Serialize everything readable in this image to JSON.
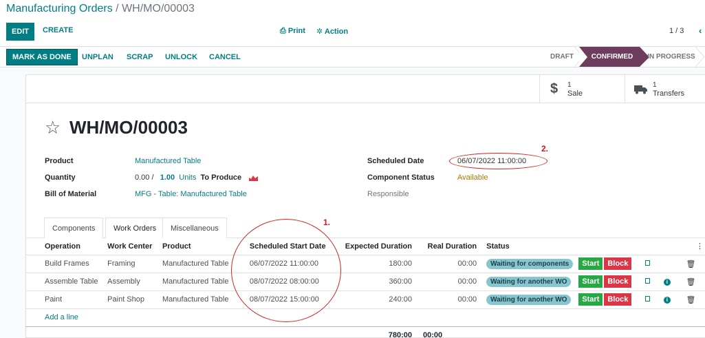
{
  "breadcrumb": {
    "parent": "Manufacturing Orders",
    "separator": " / ",
    "current": "WH/MO/00003"
  },
  "toolbar": {
    "edit_label": "EDIT",
    "create_label": "CREATE",
    "print_label": "Print",
    "action_label": "Action",
    "pager": "1 / 3"
  },
  "statusbar": {
    "mark_done_label": "MARK AS DONE",
    "buttons": [
      "UNPLAN",
      "SCRAP",
      "UNLOCK",
      "CANCEL"
    ],
    "stages": [
      {
        "label": "DRAFT",
        "active": false
      },
      {
        "label": "CONFIRMED",
        "active": true
      },
      {
        "label": "IN PROGRESS",
        "active": false
      }
    ]
  },
  "smart_buttons": [
    {
      "icon": "dollar-icon",
      "count": "1",
      "label": "Sale"
    },
    {
      "icon": "truck-icon",
      "count": "1",
      "label": "Transfers"
    }
  ],
  "record": {
    "title": "WH/MO/00003",
    "product_label": "Product",
    "product_value": "Manufactured Table",
    "quantity_label": "Quantity",
    "quantity_done": "0.00",
    "quantity_sep": " / ",
    "quantity_total": "1.00",
    "quantity_unit": "Units",
    "quantity_suffix": "To Produce",
    "bom_label": "Bill of Material",
    "bom_value": "MFG - Table: Manufactured Table",
    "scheduled_label": "Scheduled Date",
    "scheduled_value": "06/07/2022 11:00:00",
    "component_status_label": "Component Status",
    "component_status_value": "Available",
    "responsible_label": "Responsible"
  },
  "tabs": [
    {
      "label": "Components",
      "active": false
    },
    {
      "label": "Work Orders",
      "active": true
    },
    {
      "label": "Miscellaneous",
      "active": false
    }
  ],
  "work_orders": {
    "columns": [
      "Operation",
      "Work Center",
      "Product",
      "Scheduled Start Date",
      "Expected Duration",
      "Real Duration",
      "Status"
    ],
    "rows": [
      {
        "operation": "Build Frames",
        "work_center": "Framing",
        "product": "Manufactured Table",
        "start": "06/07/2022 11:00:00",
        "expected": "180:00",
        "real": "00:00",
        "status": "Waiting for components",
        "info": false
      },
      {
        "operation": "Assemble Table",
        "work_center": "Assembly",
        "product": "Manufactured Table",
        "start": "08/07/2022 08:00:00",
        "expected": "360:00",
        "real": "00:00",
        "status": "Waiting for another WO",
        "info": true
      },
      {
        "operation": "Paint",
        "work_center": "Paint Shop",
        "product": "Manufactured Table",
        "start": "08/07/2022 15:00:00",
        "expected": "240:00",
        "real": "00:00",
        "status": "Waiting for another WO",
        "info": true
      }
    ],
    "add_line_label": "Add a line",
    "start_label": "Start",
    "block_label": "Block",
    "total_expected": "780:00",
    "total_real": "00:00"
  },
  "annotations": {
    "one": "1.",
    "two": "2."
  },
  "colors": {
    "accent": "#017e84",
    "stage_active": "#6e3d5e",
    "annotation": "#d42020",
    "badge": "#87c6cf"
  }
}
